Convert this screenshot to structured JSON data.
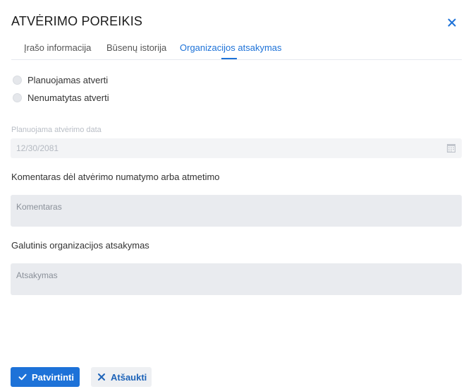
{
  "dialog": {
    "title": "ATVĖRIMO POREIKIS"
  },
  "tabs": [
    {
      "label": "Įrašo informacija",
      "active": false
    },
    {
      "label": "Būsenų istorija",
      "active": false
    },
    {
      "label": "Organizacijos atsakymas",
      "active": true
    }
  ],
  "options": [
    {
      "label": "Planuojamas atverti",
      "selected": false
    },
    {
      "label": "Nenumatytas atverti",
      "selected": false
    }
  ],
  "date": {
    "label": "Planuojama atvėrimo data",
    "value": "12/30/2081",
    "icon": "calendar-icon"
  },
  "comment": {
    "label": "Komentaras dėl atvėrimo numatymo arba atmetimo",
    "placeholder": "Komentaras"
  },
  "answer": {
    "label": "Galutinis organizacijos atsakymas",
    "placeholder": "Atsakymas"
  },
  "buttons": {
    "confirm": "Patvirtinti",
    "cancel": "Atšaukti"
  },
  "colors": {
    "accent": "#1d72d8",
    "field_bg": "#e9ebef",
    "disabled_bg": "#f3f4f6"
  }
}
